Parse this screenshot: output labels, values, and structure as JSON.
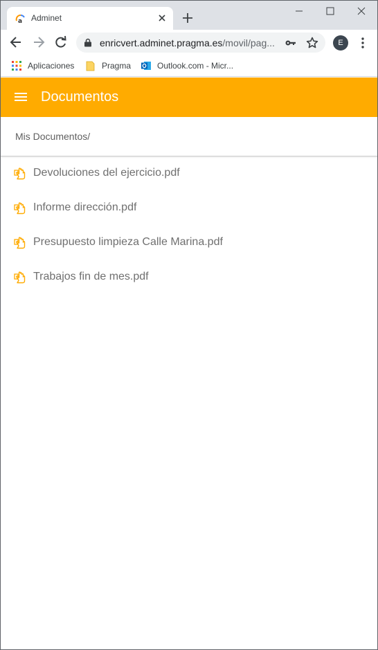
{
  "browser": {
    "tab_title": "Adminet",
    "url_host": "enricvert.adminet.pragma.es",
    "url_path": "/movil/pag...",
    "profile_initial": "E",
    "bookmarks": [
      {
        "label": "Aplicaciones",
        "icon": "apps-grid-icon"
      },
      {
        "label": "Pragma",
        "icon": "folder-icon"
      },
      {
        "label": "Outlook.com - Micr...",
        "icon": "outlook-icon"
      }
    ]
  },
  "app": {
    "title": "Documentos",
    "accent_color": "#ffab00",
    "breadcrumb": "Mis Documentos/"
  },
  "documents": [
    {
      "name": "Devoluciones del ejercicio.pdf"
    },
    {
      "name": "Informe dirección.pdf"
    },
    {
      "name": "Presupuesto limpieza Calle Marina.pdf"
    },
    {
      "name": "Trabajos fin de mes.pdf"
    }
  ]
}
